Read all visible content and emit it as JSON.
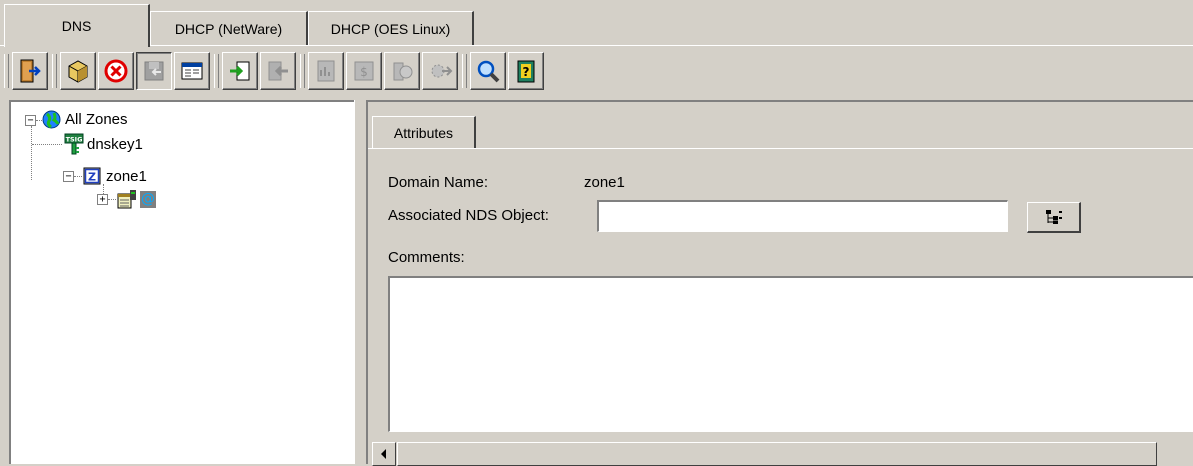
{
  "tabs": [
    {
      "label": "DNS",
      "active": true
    },
    {
      "label": "DHCP (NetWare)",
      "active": false
    },
    {
      "label": "DHCP (OES Linux)",
      "active": false
    }
  ],
  "toolbar": {
    "buttons": [
      {
        "icon": "exit-door-icon",
        "enabled": true
      },
      {
        "icon": "create-object-icon",
        "enabled": true
      },
      {
        "icon": "delete-icon",
        "enabled": true
      },
      {
        "icon": "save-icon",
        "enabled": false,
        "pressed": true
      },
      {
        "icon": "view-details-icon",
        "enabled": true
      },
      {
        "icon": "import-icon",
        "enabled": true
      },
      {
        "icon": "export-icon",
        "enabled": false
      },
      {
        "icon": "report-icon",
        "enabled": false
      },
      {
        "icon": "audit-icon",
        "enabled": false
      },
      {
        "icon": "start-server-icon",
        "enabled": false
      },
      {
        "icon": "server-service-icon",
        "enabled": false
      },
      {
        "icon": "search-icon",
        "enabled": true
      },
      {
        "icon": "help-icon",
        "enabled": true
      }
    ]
  },
  "tree": {
    "root": {
      "label": "All Zones",
      "icon": "globe-icon",
      "expanded": true
    },
    "items": [
      {
        "label": "dnskey1",
        "icon": "tsig-key-icon"
      },
      {
        "label": "zone1",
        "icon": "zone-icon",
        "expanded": true
      }
    ],
    "child_icons": [
      "resource-record-set-icon",
      "at-sign-icon"
    ],
    "child_label": "@"
  },
  "detail": {
    "tab_label": "Attributes",
    "domain_name_label": "Domain Name:",
    "domain_name_value": "zone1",
    "nds_object_label": "Associated NDS Object:",
    "nds_object_value": "",
    "comments_label": "Comments:",
    "comments_value": ""
  },
  "colors": {
    "face": "#d4d0c8",
    "shadow": "#808080",
    "highlight": "#ffffff",
    "at_sign": "#00aaff"
  }
}
